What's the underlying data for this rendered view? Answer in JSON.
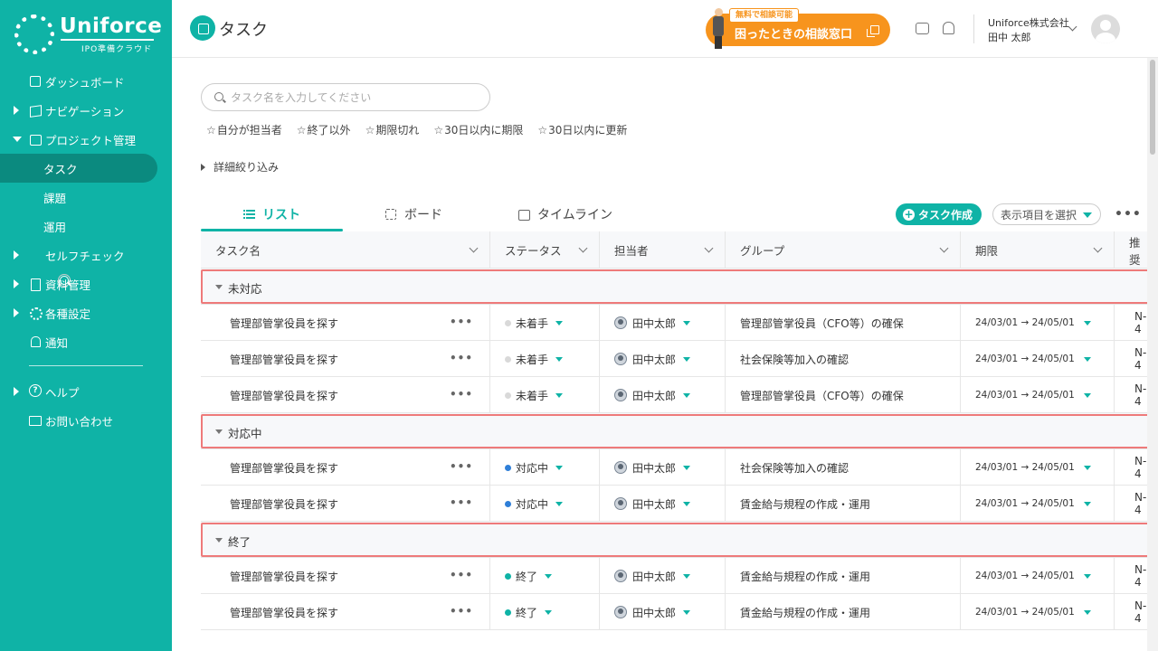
{
  "brand": {
    "name": "Uniforce",
    "sub": "IPO準備クラウド"
  },
  "sidebar": {
    "items": [
      {
        "label": "ダッシュボード",
        "icon": "grid-icon"
      },
      {
        "label": "ナビゲーション",
        "icon": "map-icon"
      },
      {
        "label": "プロジェクト管理",
        "icon": "calendar-icon"
      },
      {
        "label": "タスク"
      },
      {
        "label": "課題"
      },
      {
        "label": "運用"
      },
      {
        "label": "セルフチェック",
        "icon": "search-check-icon"
      },
      {
        "label": "資料管理",
        "icon": "document-icon"
      },
      {
        "label": "各種設定",
        "icon": "gear-icon"
      },
      {
        "label": "通知",
        "icon": "bell-icon"
      },
      {
        "label": "ヘルプ",
        "icon": "help-icon"
      },
      {
        "label": "お問い合わせ",
        "icon": "mail-icon"
      }
    ]
  },
  "header": {
    "title": "タスク",
    "consult_badge": "無料で相談可能",
    "consult_label": "困ったときの相談窓口",
    "company": "Uniforce株式会社",
    "user": "田中 太郎"
  },
  "search": {
    "placeholder": "タスク名を入力してください",
    "value": ""
  },
  "quick_filters": [
    "自分が担当者",
    "終了以外",
    "期限切れ",
    "30日以内に期限",
    "30日以内に更新"
  ],
  "detail_filter": "詳細絞り込み",
  "tabs": [
    "リスト",
    "ボード",
    "タイムライン"
  ],
  "toolbar": {
    "create_label": "タスク作成",
    "column_select": "表示項目を選択",
    "more": "•••"
  },
  "table": {
    "columns": [
      "タスク名",
      "ステータス",
      "担当者",
      "グループ",
      "期限",
      "推奨"
    ],
    "groups": [
      {
        "label": "未対応",
        "rows": [
          {
            "name": "管理部管掌役員を探す",
            "status": "未着手",
            "owner": "田中太郎",
            "group": "管理部管掌役員（CFO等）の確保",
            "due": "24/03/01 → 24/05/01",
            "extra": "N-4"
          },
          {
            "name": "管理部管掌役員を探す",
            "status": "未着手",
            "owner": "田中太郎",
            "group": "社会保険等加入の確認",
            "due": "24/03/01 → 24/05/01",
            "extra": "N-4"
          },
          {
            "name": "管理部管掌役員を探す",
            "status": "未着手",
            "owner": "田中太郎",
            "group": "管理部管掌役員（CFO等）の確保",
            "due": "24/03/01 → 24/05/01",
            "extra": "N-4"
          }
        ]
      },
      {
        "label": "対応中",
        "rows": [
          {
            "name": "管理部管掌役員を探す",
            "status": "対応中",
            "owner": "田中太郎",
            "group": "社会保険等加入の確認",
            "due": "24/03/01 → 24/05/01",
            "extra": "N-4"
          },
          {
            "name": "管理部管掌役員を探す",
            "status": "対応中",
            "owner": "田中太郎",
            "group": "賃金給与規程の作成・運用",
            "due": "24/03/01 → 24/05/01",
            "extra": "N-4"
          }
        ]
      },
      {
        "label": "終了",
        "rows": [
          {
            "name": "管理部管掌役員を探す",
            "status": "終了",
            "owner": "田中太郎",
            "group": "賃金給与規程の作成・運用",
            "due": "24/03/01 → 24/05/01",
            "extra": "N-4"
          },
          {
            "name": "管理部管掌役員を探す",
            "status": "終了",
            "owner": "田中太郎",
            "group": "賃金給与規程の作成・運用",
            "due": "24/03/01 → 24/05/01",
            "extra": "N-4"
          }
        ]
      }
    ]
  },
  "colors": {
    "brand": "#0fb3a6",
    "active_nav": "#0b8a7f",
    "consult": "#f7941d",
    "status_todo": "#d9d9d9",
    "status_doing": "#2f7fd8",
    "status_done": "#0fb3a6",
    "highlight": "#ee7a7a"
  }
}
